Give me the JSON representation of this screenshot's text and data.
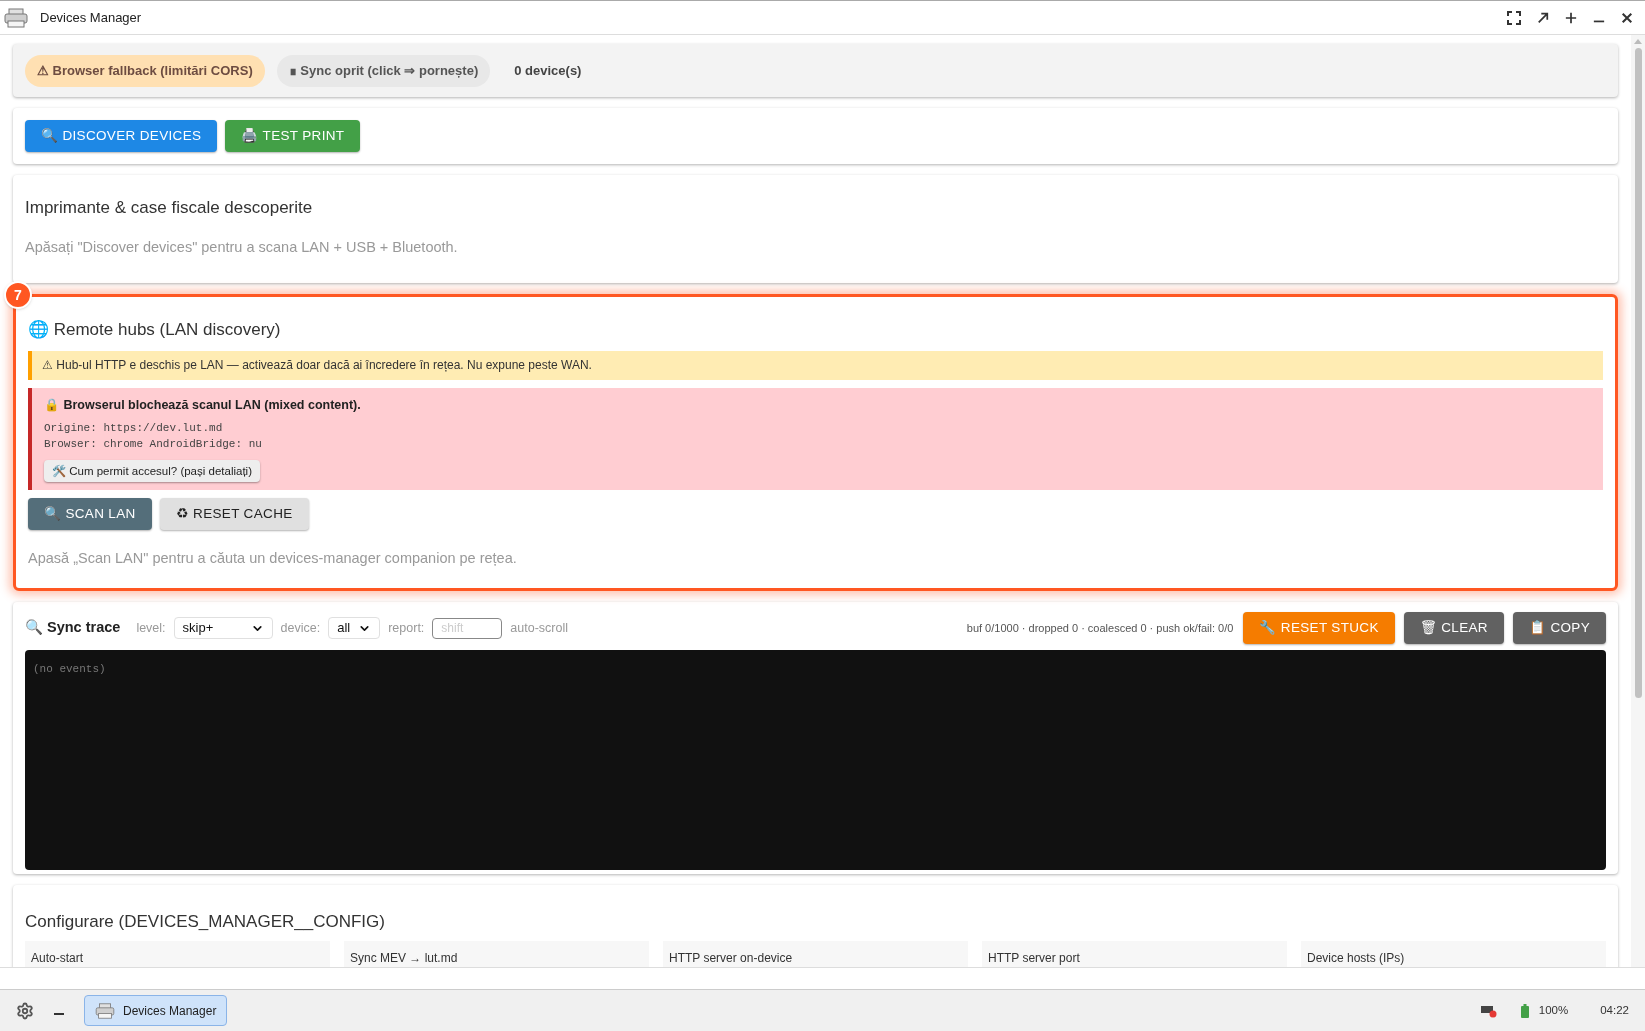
{
  "window": {
    "title": "Devices Manager"
  },
  "status_chips": [
    {
      "kind": "warning",
      "label": "⚠ Browser fallback (limitări CORS)"
    },
    {
      "kind": "sync",
      "label": "∎ Sync oprit (click ⇒ pornește)"
    },
    {
      "kind": "plain",
      "label": "0 device(s)"
    }
  ],
  "actions": [
    {
      "label": "🔍 DISCOVER DEVICES",
      "color": "#1e88e5"
    },
    {
      "label": "🖨️ TEST PRINT",
      "color": "#43a047"
    }
  ],
  "discovered": {
    "title": "Imprimante & case fiscale descoperite",
    "hint": "Apăsați \"Discover devices\" pentru a scana LAN + USB + Bluetooth."
  },
  "remote_hubs": {
    "badge": "7",
    "highlighted": true,
    "title": "🌐 Remote hubs (LAN discovery)",
    "warning": "⚠ Hub-ul HTTP e deschis pe LAN — activează doar dacă ai încredere în rețea. Nu expune peste WAN.",
    "error": {
      "title": "🔒 Browserul blochează scanul LAN (mixed content).",
      "lines": [
        "Origine: https://dev.lut.md",
        "Browser: chrome AndroidBridge: nu"
      ],
      "help_button": "🛠️ Cum permit accesul? (pași detaliați)"
    },
    "buttons": [
      {
        "label": "🔍 SCAN LAN",
        "kind": "dark"
      },
      {
        "label": "♻ RESET CACHE",
        "kind": "light"
      }
    ],
    "hint": "Apasă „Scan LAN\" pentru a căuta un devices-manager companion pe rețea."
  },
  "sync_trace": {
    "title": "🔍 Sync trace",
    "filters": [
      {
        "kind": "select",
        "label": "level:",
        "value": "skip+"
      },
      {
        "kind": "select",
        "label": "device:",
        "value": "all"
      },
      {
        "kind": "input",
        "label": "report:",
        "placeholder": "shift"
      }
    ],
    "auto_scroll": "auto-scroll",
    "stats": "buf 0/1000 · dropped 0 · coalesced 0 · push ok/fail: 0/0",
    "buttons": [
      {
        "label": "🔧 RESET STUCK",
        "color": "#f57c00"
      },
      {
        "label": "🗑 CLEAR",
        "color": "#616161"
      },
      {
        "label": "📋 COPY",
        "color": "#616161"
      }
    ],
    "log": "(no events)"
  },
  "config": {
    "title": "Configurare (DEVICES_MANAGER__CONFIG)",
    "fields": [
      "Auto-start",
      "Sync MEV → lut.md",
      "HTTP server on-device",
      "HTTP server port",
      "Device hosts (IPs)"
    ]
  },
  "taskbar": {
    "apps": [
      {
        "label": "Devices Manager",
        "selected": true
      }
    ],
    "battery": "100%",
    "clock": "04:22"
  }
}
